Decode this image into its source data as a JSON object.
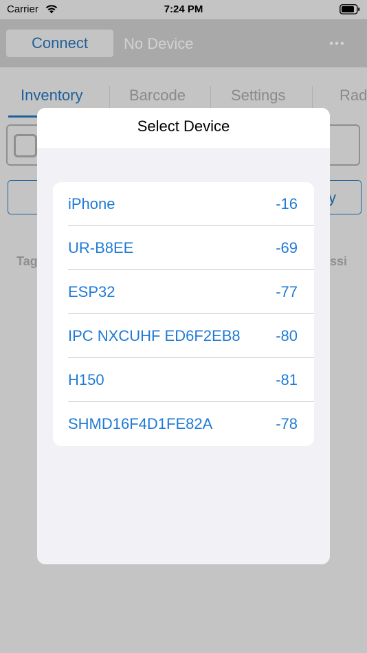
{
  "status_bar": {
    "carrier": "Carrier",
    "time": "7:24 PM"
  },
  "nav_bar": {
    "connect_label": "Connect",
    "device_status": "No Device",
    "more_icon": "ellipsis-icon"
  },
  "tabs": [
    {
      "label": "Inventory",
      "active": true
    },
    {
      "label": "Barcode",
      "active": false
    },
    {
      "label": "Settings",
      "active": false
    },
    {
      "label": "Rad",
      "active": false
    }
  ],
  "background": {
    "button_label_fragment": "y",
    "left_label_fragment": "Tag",
    "right_label_fragment": "ssi"
  },
  "modal": {
    "title": "Select Device",
    "devices": [
      {
        "name": "iPhone",
        "rssi": "-16"
      },
      {
        "name": "UR-B8EE",
        "rssi": "-69"
      },
      {
        "name": "ESP32",
        "rssi": "-77"
      },
      {
        "name": "IPC NXCUHF ED6F2EB8",
        "rssi": "-80"
      },
      {
        "name": "H150",
        "rssi": "-81"
      },
      {
        "name": "SHMD16F4D1FE82A",
        "rssi": "-78"
      }
    ]
  },
  "colors": {
    "accent": "#1f7ad6",
    "dim_accent": "#1f5f9a",
    "overlay": "#c4c4c4",
    "modal_bg": "#f1f1f6"
  }
}
